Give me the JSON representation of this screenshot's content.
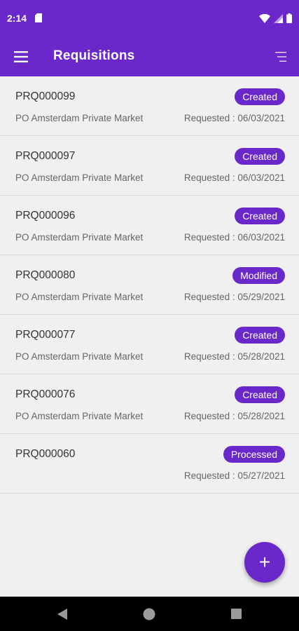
{
  "status_bar": {
    "time": "2:14"
  },
  "app_bar": {
    "title": "Requisitions"
  },
  "requisitions": [
    {
      "id": "PRQ000099",
      "location": "PO Amsterdam Private Market",
      "status": "Created",
      "requested": "Requested : 06/03/2021"
    },
    {
      "id": "PRQ000097",
      "location": "PO Amsterdam Private Market",
      "status": "Created",
      "requested": "Requested : 06/03/2021"
    },
    {
      "id": "PRQ000096",
      "location": "PO Amsterdam Private Market",
      "status": "Created",
      "requested": "Requested : 06/03/2021"
    },
    {
      "id": "PRQ000080",
      "location": "PO Amsterdam Private Market",
      "status": "Modified",
      "requested": "Requested : 05/29/2021"
    },
    {
      "id": "PRQ000077",
      "location": "PO Amsterdam Private Market",
      "status": "Created",
      "requested": "Requested : 05/28/2021"
    },
    {
      "id": "PRQ000076",
      "location": "PO Amsterdam Private Market",
      "status": "Created",
      "requested": "Requested : 05/28/2021"
    },
    {
      "id": "PRQ000060",
      "location": "",
      "status": "Processed",
      "requested": "Requested : 05/27/2021"
    }
  ],
  "fab": {
    "label": "+"
  },
  "icons": {
    "menu": "menu-icon",
    "filter": "filter-icon",
    "add": "add-icon",
    "back": "back-icon",
    "home": "home-icon",
    "recents": "recents-icon"
  },
  "colors": {
    "primary": "#6a27c9",
    "background": "#f0f0f0",
    "badge_text": "#ffffff"
  }
}
